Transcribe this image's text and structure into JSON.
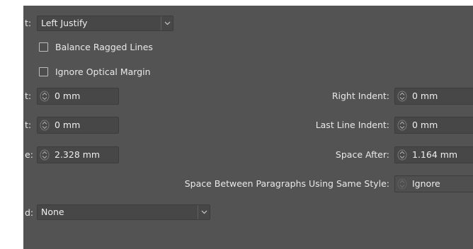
{
  "alignment": {
    "label_fragment": "t:",
    "value": "Left Justify",
    "arrow_icon": "chevron-down-icon"
  },
  "options": {
    "balance_ragged_lines": {
      "label": "Balance Ragged Lines",
      "checked": false
    },
    "ignore_optical_margin": {
      "label": "Ignore Optical Margin",
      "checked": false
    }
  },
  "fields": {
    "left_indent": {
      "label_fragment": "t:",
      "value": "0 mm"
    },
    "right_indent": {
      "label": "Right Indent:",
      "value": "0 mm"
    },
    "first_line_indent": {
      "label_fragment": "t:",
      "value": "0 mm"
    },
    "last_line_indent": {
      "label": "Last Line Indent:",
      "value": "0 mm"
    },
    "space_before": {
      "label_fragment": "e:",
      "value": "2.328 mm"
    },
    "space_after": {
      "label": "Space After:",
      "value": "1.164 mm"
    },
    "space_between": {
      "label": "Space Between Paragraphs Using Same Style:",
      "value": "Ignore"
    }
  },
  "align_to_grid": {
    "label_fragment": "d:",
    "value": "None",
    "arrow_icon": "chevron-down-icon"
  },
  "colors": {
    "panel": "#535353",
    "field": "#474747",
    "text": "#e9e9e9"
  }
}
